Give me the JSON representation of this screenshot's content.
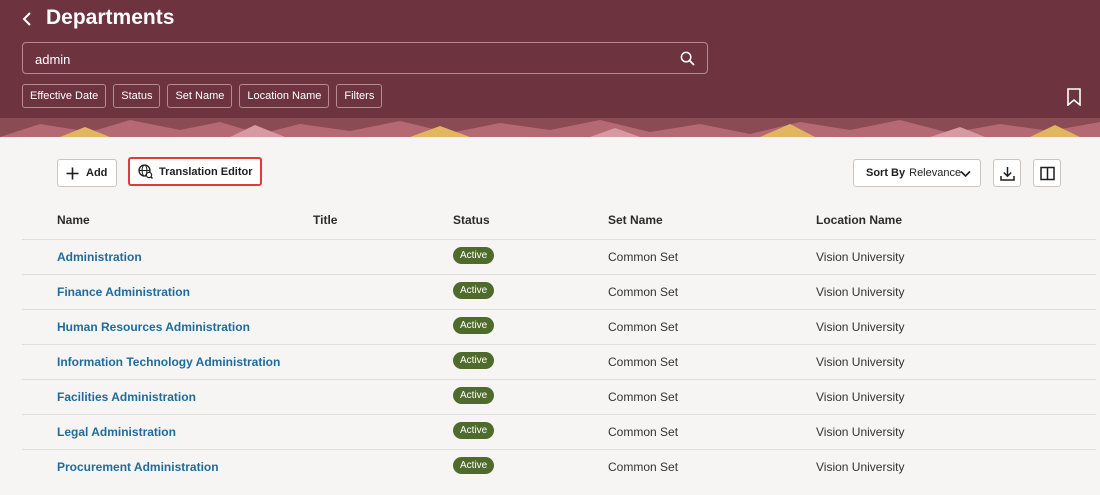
{
  "header": {
    "title": "Departments",
    "search_value": "admin",
    "filters": [
      "Effective Date",
      "Status",
      "Set Name",
      "Location Name",
      "Filters"
    ]
  },
  "toolbar": {
    "add_label": "Add",
    "translation_label": "Translation Editor",
    "sort_label": "Sort By",
    "sort_value": "Relevance"
  },
  "table": {
    "columns": [
      "Name",
      "Title",
      "Status",
      "Set Name",
      "Location Name"
    ],
    "rows": [
      {
        "name": "Administration",
        "title": "",
        "status": "Active",
        "set": "Common Set",
        "location": "Vision University"
      },
      {
        "name": "Finance Administration",
        "title": "",
        "status": "Active",
        "set": "Common Set",
        "location": "Vision University"
      },
      {
        "name": "Human Resources Administration",
        "title": "",
        "status": "Active",
        "set": "Common Set",
        "location": "Vision University"
      },
      {
        "name": "Information Technology Administration",
        "title": "",
        "status": "Active",
        "set": "Common Set",
        "location": "Vision University"
      },
      {
        "name": "Facilities Administration",
        "title": "",
        "status": "Active",
        "set": "Common Set",
        "location": "Vision University"
      },
      {
        "name": "Legal Administration",
        "title": "",
        "status": "Active",
        "set": "Common Set",
        "location": "Vision University"
      },
      {
        "name": "Procurement Administration",
        "title": "",
        "status": "Active",
        "set": "Common Set",
        "location": "Vision University"
      }
    ]
  },
  "colors": {
    "header_bg": "#6d333f",
    "link": "#1f6c9c",
    "active_badge": "#4e6b2c",
    "highlight": "#e03a3a"
  },
  "icons": [
    "back-arrow-icon",
    "search-icon",
    "bookmark-icon",
    "plus-icon",
    "globe-translate-icon",
    "chevron-down-icon",
    "download-icon",
    "columns-icon"
  ]
}
